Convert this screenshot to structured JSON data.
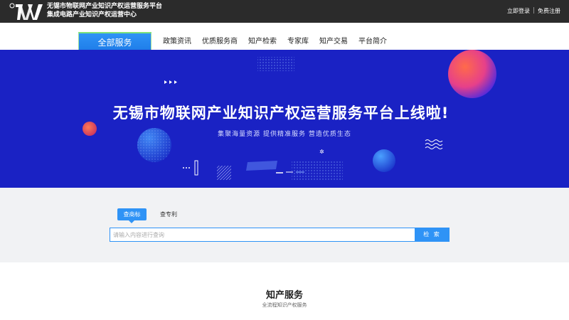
{
  "header": {
    "logo_icon": "tw-logo-mark",
    "logo_line1": "无锡市物联网产业知识产权运营服务平台",
    "logo_line2": "集成电路产业知识产权运营中心",
    "login_label": "立即登录",
    "register_label": "免费注册"
  },
  "nav": {
    "all_services": "全部服务",
    "items": [
      {
        "label": "政策资讯"
      },
      {
        "label": "优质服务商"
      },
      {
        "label": "知产检索"
      },
      {
        "label": "专家库"
      },
      {
        "label": "知产交易"
      },
      {
        "label": "平台简介"
      }
    ]
  },
  "banner": {
    "title": "无锡市物联网产业知识产权运营服务平台上线啦!",
    "subtitle": "集聚海量资源   提供精准服务   营造优质生态",
    "background_color": "#1a22c4"
  },
  "search": {
    "tabs": [
      {
        "label": "查商标",
        "active": true
      },
      {
        "label": "查专利",
        "active": false
      }
    ],
    "placeholder": "请输入内容进行查询",
    "value": "",
    "button_label": "检 索"
  },
  "services": {
    "title": "知产服务",
    "subtitle": "全流程知识产权服务"
  },
  "colors": {
    "accent": "#2f93f6",
    "topbar": "#2b2b2b"
  }
}
